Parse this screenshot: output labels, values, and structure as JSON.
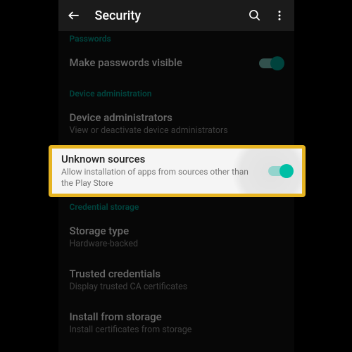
{
  "appBar": {
    "title": "Security"
  },
  "sections": {
    "passwords": {
      "header": "Passwords",
      "makeVisible": {
        "title": "Make passwords visible"
      }
    },
    "deviceAdmin": {
      "header": "Device administration",
      "administrators": {
        "title": "Device administrators",
        "subtitle": "View or deactivate device administrators"
      },
      "unknownSources": {
        "title": "Unknown sources",
        "subtitle": "Allow installation of apps from sources other than the Play Store"
      }
    },
    "credentialStorage": {
      "header": "Credential storage",
      "storageType": {
        "title": "Storage type",
        "subtitle": "Hardware-backed"
      },
      "trustedCredentials": {
        "title": "Trusted credentials",
        "subtitle": "Display trusted CA certificates"
      },
      "installFromStorage": {
        "title": "Install from storage",
        "subtitle": "Install certificates from storage"
      }
    }
  }
}
